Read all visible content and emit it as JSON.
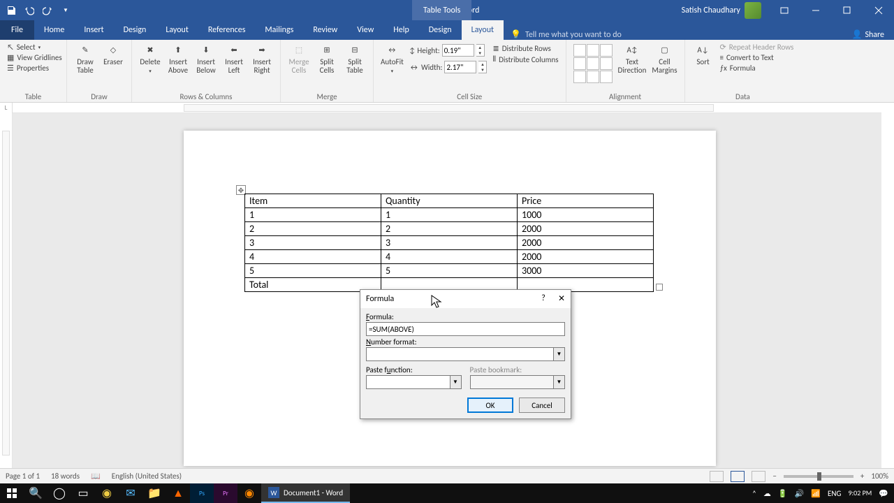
{
  "title": {
    "document": "Document1 - Word",
    "context": "Table Tools",
    "user": "Satish Chaudhary"
  },
  "tabs": {
    "file": "File",
    "home": "Home",
    "insert": "Insert",
    "design_main": "Design",
    "layout_main": "Layout",
    "references": "References",
    "mailings": "Mailings",
    "review": "Review",
    "view": "View",
    "help": "Help",
    "design_ctx": "Design",
    "layout_ctx": "Layout",
    "tell_me": "Tell me what you want to do",
    "share": "Share"
  },
  "ribbon": {
    "table": {
      "select": "Select",
      "gridlines": "View Gridlines",
      "properties": "Properties",
      "group": "Table"
    },
    "draw": {
      "draw_table": "Draw\nTable",
      "eraser": "Eraser",
      "group": "Draw"
    },
    "rows_cols": {
      "delete": "Delete",
      "insert_above": "Insert\nAbove",
      "insert_below": "Insert\nBelow",
      "insert_left": "Insert\nLeft",
      "insert_right": "Insert\nRight",
      "group": "Rows & Columns"
    },
    "merge": {
      "merge_cells": "Merge\nCells",
      "split_cells": "Split\nCells",
      "split_table": "Split\nTable",
      "group": "Merge"
    },
    "cell_size": {
      "autofit": "AutoFit",
      "height_label": "Height:",
      "height_value": "0.19\"",
      "width_label": "Width:",
      "width_value": "2.17\"",
      "dist_rows": "Distribute Rows",
      "dist_cols": "Distribute Columns",
      "group": "Cell Size"
    },
    "alignment": {
      "text_direction": "Text\nDirection",
      "cell_margins": "Cell\nMargins",
      "group": "Alignment"
    },
    "data": {
      "sort": "Sort",
      "repeat_headers": "Repeat Header Rows",
      "convert_text": "Convert to Text",
      "formula": "Formula",
      "group": "Data"
    }
  },
  "doc_table": {
    "headers": [
      "Item",
      "Quantity",
      "Price"
    ],
    "rows": [
      [
        "1",
        "1",
        "1000"
      ],
      [
        "2",
        "2",
        "2000"
      ],
      [
        "3",
        "3",
        "2000"
      ],
      [
        "4",
        "4",
        "2000"
      ],
      [
        "5",
        "5",
        "3000"
      ]
    ],
    "footer": [
      "Total",
      "",
      ""
    ]
  },
  "dialog": {
    "title": "Formula",
    "formula_label": "Formula:",
    "formula_value": "=SUM(ABOVE)",
    "number_format_label": "Number format:",
    "number_format_value": "",
    "paste_function_label": "Paste function:",
    "paste_function_value": "",
    "paste_bookmark_label": "Paste bookmark:",
    "paste_bookmark_value": "",
    "ok": "OK",
    "cancel": "Cancel"
  },
  "status": {
    "page": "Page 1 of 1",
    "words": "18 words",
    "language": "English (United States)",
    "zoom": "100%"
  },
  "taskbar": {
    "app_label": "Document1 - Word",
    "lang": "ENG",
    "time": "9:02 PM"
  },
  "ruler_corner": "L"
}
